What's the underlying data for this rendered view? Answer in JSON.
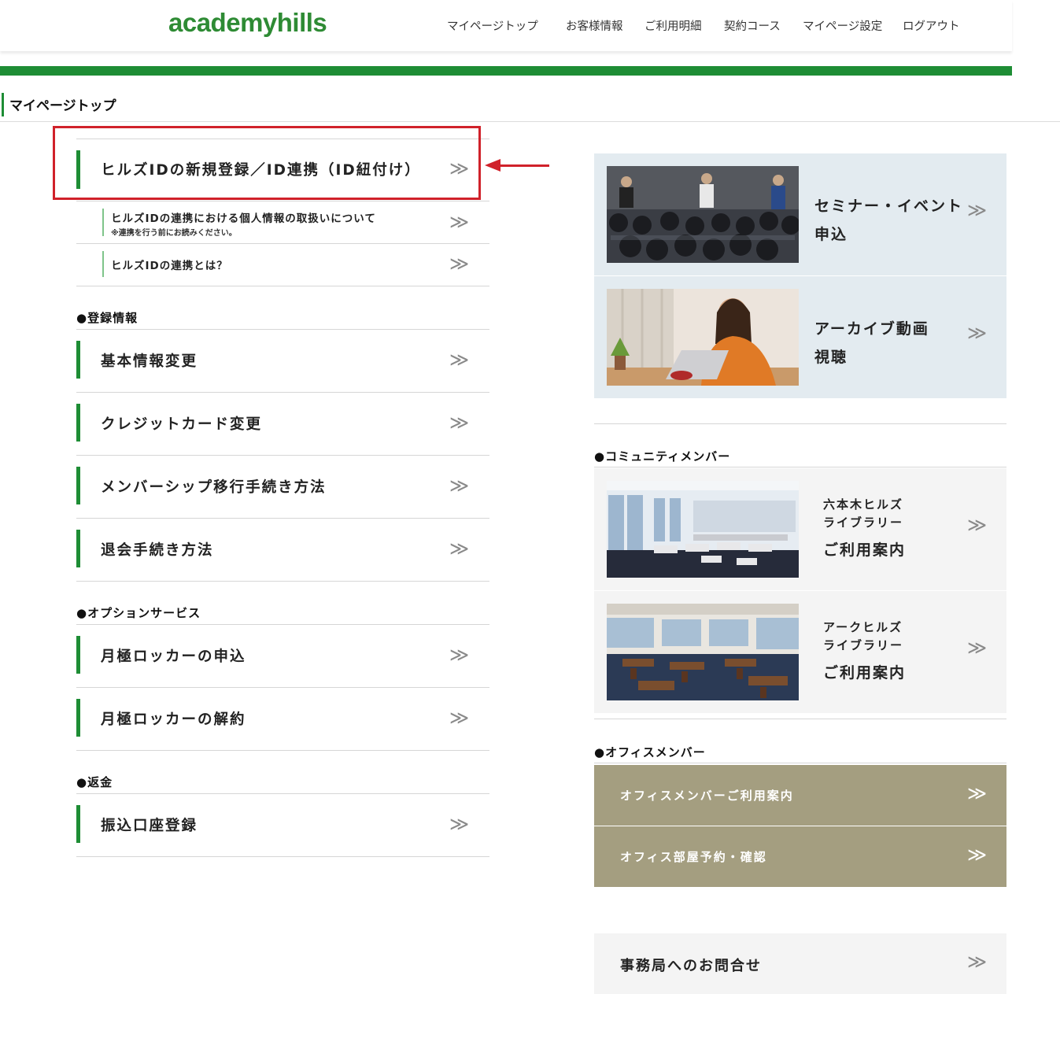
{
  "header": {
    "logo": "academyhills",
    "nav": [
      "マイページトップ",
      "お客様情報",
      "ご利用明細",
      "契約コース",
      "マイページ設定",
      "ログアウト"
    ]
  },
  "breadcrumb": "マイページトップ",
  "chevron": "≫",
  "hills_id": {
    "main": "ヒルズIDの新規登録／ID連携（ID紐付け）",
    "privacy": "ヒルズIDの連携における個人情報の取扱いについて",
    "privacy_note": "※連携を行う前にお読みください。",
    "about": "ヒルズIDの連携とは？"
  },
  "registration": {
    "heading": "●登録情報",
    "items": [
      "基本情報変更",
      "クレジットカード変更",
      "メンバーシップ移行手続き方法",
      "退会手続き方法"
    ]
  },
  "options": {
    "heading": "●オプションサービス",
    "items": [
      "月極ロッカーの申込",
      "月極ロッカーの解約"
    ]
  },
  "refund": {
    "heading": "●返金",
    "items": [
      "振込口座登録"
    ]
  },
  "cards": {
    "seminar": [
      "セミナー・イベント",
      "申込"
    ],
    "archive": [
      "アーカイブ動画",
      "視聴"
    ]
  },
  "community": {
    "heading": "●コミュニティメンバー",
    "roppongi": [
      "六本木ヒルズ",
      "ライブラリー",
      "ご利用案内"
    ],
    "ark": [
      "アークヒルズ",
      "ライブラリー",
      "ご利用案内"
    ]
  },
  "office": {
    "heading": "●オフィスメンバー",
    "items": [
      "オフィスメンバーご利用案内",
      "オフィス部屋予約・確認"
    ]
  },
  "contact": "事務局へのお問合せ",
  "colors": {
    "brand_green": "#1e8d35",
    "office_khaki": "#a49e80",
    "highlight_red": "#d0212a"
  }
}
